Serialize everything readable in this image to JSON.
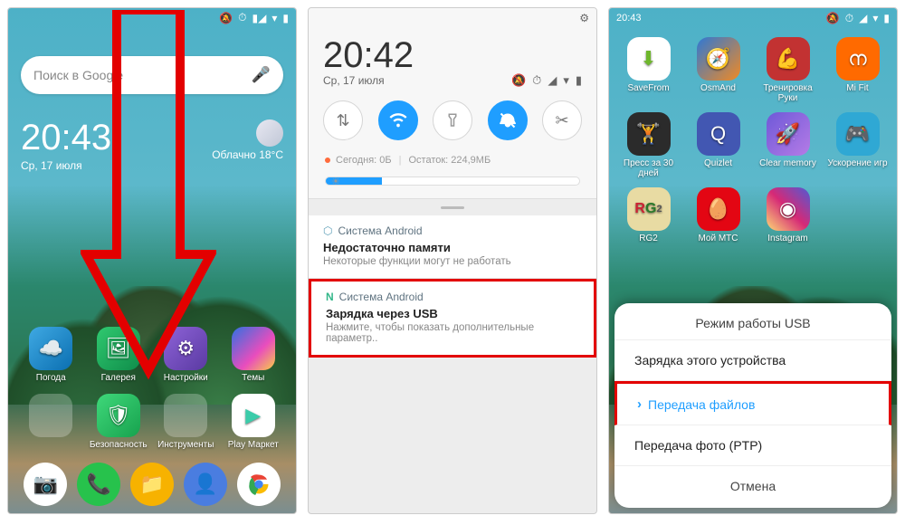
{
  "screen1": {
    "status": {
      "time_small": " "
    },
    "search_placeholder": "Поиск в Google",
    "clock": {
      "time": "20:43",
      "date": "Ср, 17 июля"
    },
    "weather": {
      "cond": "Облачно",
      "temp": "18°С"
    },
    "apps": {
      "r1": [
        "Погода",
        "Галерея",
        "Настройки",
        "Темы"
      ],
      "r2": [
        "Безопасность",
        "Инструменты",
        "",
        "Play Маркет"
      ],
      "folder_label": "",
      "sec_label": "Безопасность",
      "tools_label": "Инструменты"
    }
  },
  "screen2": {
    "time": "20:42",
    "date": "Ср, 17 июля",
    "storage": {
      "today": "Сегодня: 0Б",
      "remain": "Остаток: 224,9МБ"
    },
    "toggles": [
      "data",
      "wifi",
      "flashlight",
      "sound",
      "scissors"
    ],
    "notif1": {
      "app": "Система Android",
      "title": "Недостаточно памяти",
      "text": "Некоторые функции могут не работать"
    },
    "notif2": {
      "app": "Система Android",
      "title": "Зарядка через USB",
      "text": "Нажмите, чтобы показать дополнительные параметр.."
    }
  },
  "screen3": {
    "status_time": "20:43",
    "apps_row1": [
      "SaveFrom",
      "OsmAnd",
      "Тренировка Руки",
      "Mi Fit"
    ],
    "apps_row2": [
      "Пресс за 30 дней",
      "Quizlet",
      "Clear memory",
      "Ускорение игр"
    ],
    "apps_row3": [
      "RG2",
      "Мой МТС",
      "Instagram",
      ""
    ],
    "sheet": {
      "title": "Режим работы USB",
      "opt1": "Зарядка этого устройства",
      "opt2": "Передача файлов",
      "opt3": "Передача фото (PTP)",
      "cancel": "Отмена"
    }
  }
}
